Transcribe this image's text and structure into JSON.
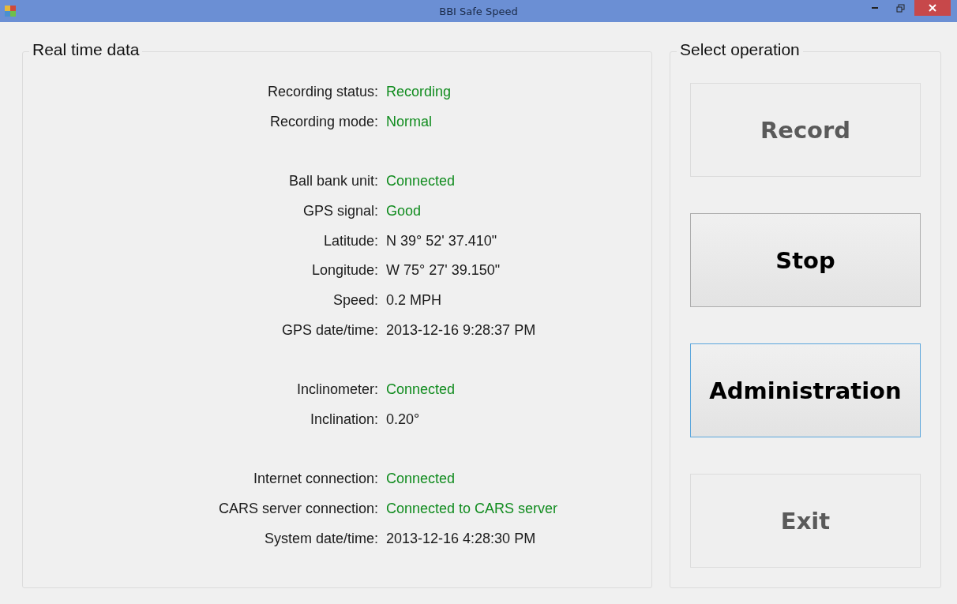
{
  "window": {
    "title": "BBI Safe Speed"
  },
  "realtime": {
    "title": "Real time data",
    "groups": [
      [
        {
          "label": "Recording status:",
          "value": "Recording",
          "kind": "status"
        },
        {
          "label": "Recording mode:",
          "value": "Normal",
          "kind": "status"
        }
      ],
      [
        {
          "label": "Ball bank unit:",
          "value": "Connected",
          "kind": "status"
        },
        {
          "label": "GPS signal:",
          "value": "Good",
          "kind": "status"
        },
        {
          "label": "Latitude:",
          "value": "N 39° 52' 37.410\"",
          "kind": "reading"
        },
        {
          "label": "Longitude:",
          "value": "W 75° 27' 39.150\"",
          "kind": "reading"
        },
        {
          "label": "Speed:",
          "value": "0.2 MPH",
          "kind": "reading"
        },
        {
          "label": "GPS date/time:",
          "value": "2013-12-16 9:28:37 PM",
          "kind": "reading"
        }
      ],
      [
        {
          "label": "Inclinometer:",
          "value": "Connected",
          "kind": "status"
        },
        {
          "label": "Inclination:",
          "value": "0.20°",
          "kind": "reading"
        }
      ],
      [
        {
          "label": "Internet connection:",
          "value": "Connected",
          "kind": "status"
        },
        {
          "label": "CARS server connection:",
          "value": "Connected to CARS server",
          "kind": "status"
        },
        {
          "label": "System date/time:",
          "value": "2013-12-16 4:28:30 PM",
          "kind": "reading"
        }
      ]
    ]
  },
  "operations": {
    "title": "Select operation",
    "buttons": [
      {
        "label": "Record",
        "disabled": true,
        "focused": false
      },
      {
        "label": "Stop",
        "disabled": false,
        "focused": false
      },
      {
        "label": "Administration",
        "disabled": false,
        "focused": true
      },
      {
        "label": "Exit",
        "disabled": true,
        "focused": false
      }
    ]
  }
}
